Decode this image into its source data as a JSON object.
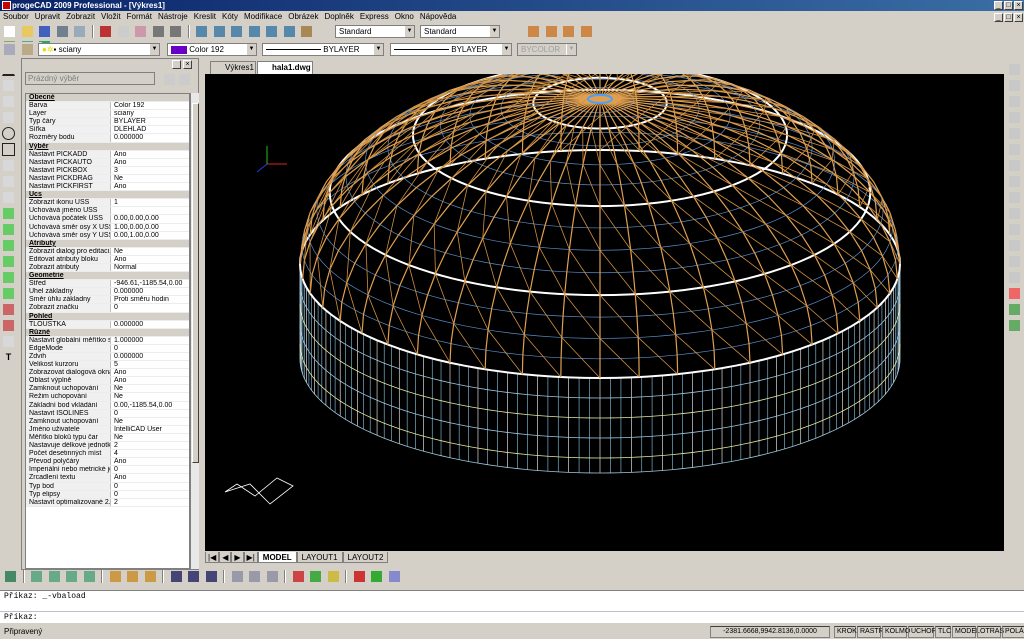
{
  "app": {
    "title": "progeCAD 2009 Professional - [Výkres1]"
  },
  "menu": [
    "Soubor",
    "Upravit",
    "Zobrazit",
    "Vložit",
    "Formát",
    "Nástroje",
    "Kreslit",
    "Kóty",
    "Modifikace",
    "Obrázek",
    "Doplněk",
    "Express",
    "Okno",
    "Nápověda"
  ],
  "toolbar": {
    "textstyle": "Standard",
    "dimstyle": "Standard",
    "layer": "sciany",
    "color": "Color 192",
    "linetype": "BYLAYER",
    "lineweight": "BYLAYER",
    "plotstyle": "BYCOLOR",
    "color_swatch": "#6a00c8"
  },
  "properties": {
    "selection": "Prázdný výběr",
    "rows": [
      {
        "k": "Obecné",
        "sec": true
      },
      {
        "k": "Barva",
        "v": "Color 192"
      },
      {
        "k": "Layer",
        "v": "sciany"
      },
      {
        "k": "Typ čáry",
        "v": "BYLAYER"
      },
      {
        "k": "Šířka",
        "v": "DLEHLAD"
      },
      {
        "k": "Rozměry bodu",
        "v": "0.000000"
      },
      {
        "k": "Výběr",
        "sec": true
      },
      {
        "k": "Nastavit PICKADD",
        "v": "Ano"
      },
      {
        "k": "Nastavit PICKAUTO",
        "v": "Ano"
      },
      {
        "k": "Nastavit PICKBOX",
        "v": "3"
      },
      {
        "k": "Nastavit PICKDRAG",
        "v": "Ne"
      },
      {
        "k": "Nastavit PICKFIRST",
        "v": "Ano"
      },
      {
        "k": "Ucs",
        "sec": true
      },
      {
        "k": "Zobrazit ikonu USS",
        "v": "1"
      },
      {
        "k": "Uchovává jméno USS",
        "v": ""
      },
      {
        "k": "Uchovává počátek USS",
        "v": "0.00,0.00,0.00"
      },
      {
        "k": "Uchovává směr osy X USS",
        "v": "1.00,0.00,0.00"
      },
      {
        "k": "Uchovává směr osy Y USS",
        "v": "0.00,1.00,0.00"
      },
      {
        "k": "Atributy",
        "sec": true
      },
      {
        "k": "Zobrazit dialog pro editaci...",
        "v": "Ne"
      },
      {
        "k": "Editovat atributy bloku",
        "v": "Ano"
      },
      {
        "k": "Zobrazit atributy",
        "v": "Normal"
      },
      {
        "k": "Geometrie",
        "sec": true
      },
      {
        "k": "Střed",
        "v": "-946.61,-1185.54,0.00"
      },
      {
        "k": "Úhel základny",
        "v": "0.000000"
      },
      {
        "k": "Směr úhlu základny",
        "v": "Proti směru hodin"
      },
      {
        "k": "Zobrazit značku",
        "v": "0"
      },
      {
        "k": "Pohled",
        "sec": true
      },
      {
        "k": "TLOUŠŤKA",
        "v": "0.000000"
      },
      {
        "k": "Různé",
        "sec": true
      },
      {
        "k": "Nastavit globální měřítko st...",
        "v": "1.000000"
      },
      {
        "k": "EdgeMode",
        "v": "0"
      },
      {
        "k": "Zdvih",
        "v": "0.000000"
      },
      {
        "k": "Velikost kurzoru",
        "v": "5"
      },
      {
        "k": "Zobrazovat dialogová okna",
        "v": "Ano"
      },
      {
        "k": "Oblast výplně",
        "v": "Ano"
      },
      {
        "k": "Zamknout uchopování",
        "v": "Ne"
      },
      {
        "k": "Režim uchopování",
        "v": "Ne"
      },
      {
        "k": "Základní bod vkládání",
        "v": "0.00,-1185.54,0.00"
      },
      {
        "k": "Nastavit ISOLINES",
        "v": "0"
      },
      {
        "k": "Zamknout uchopování",
        "v": "Ne"
      },
      {
        "k": "Jméno uživatele",
        "v": "IntelliCAD User"
      },
      {
        "k": "Měřítko bloků typu čar",
        "v": "Ne"
      },
      {
        "k": "Nastavuje délkové jednotky",
        "v": "2"
      },
      {
        "k": "Počet desetinných míst",
        "v": "4"
      },
      {
        "k": "Převod polyčáry",
        "v": "Ano"
      },
      {
        "k": "Imperiální nebo metrické je...",
        "v": "0"
      },
      {
        "k": "Zrcadlení textu",
        "v": "Ano"
      },
      {
        "k": "Typ bod",
        "v": "0"
      },
      {
        "k": "Typ elipsy",
        "v": "0"
      },
      {
        "k": "Nastavit optimalizované 2...",
        "v": "2"
      }
    ]
  },
  "doc_tabs": [
    "Výkres1",
    "hala1.dwg"
  ],
  "layout_tabs": [
    "MODEL",
    "LAYOUT1",
    "LAYOUT2"
  ],
  "command": {
    "line1": "Příkaz:  _-vbaload",
    "line2": "Příkaz:"
  },
  "status": {
    "text": "Připravený",
    "coords": "-2381.6668,9942.8136,0.0000",
    "buttons": [
      "KROK",
      "RASTR",
      "KOLMO",
      "UCHOP",
      "TLČ",
      "MODEL",
      "OTRAS",
      "POLÁR"
    ]
  }
}
